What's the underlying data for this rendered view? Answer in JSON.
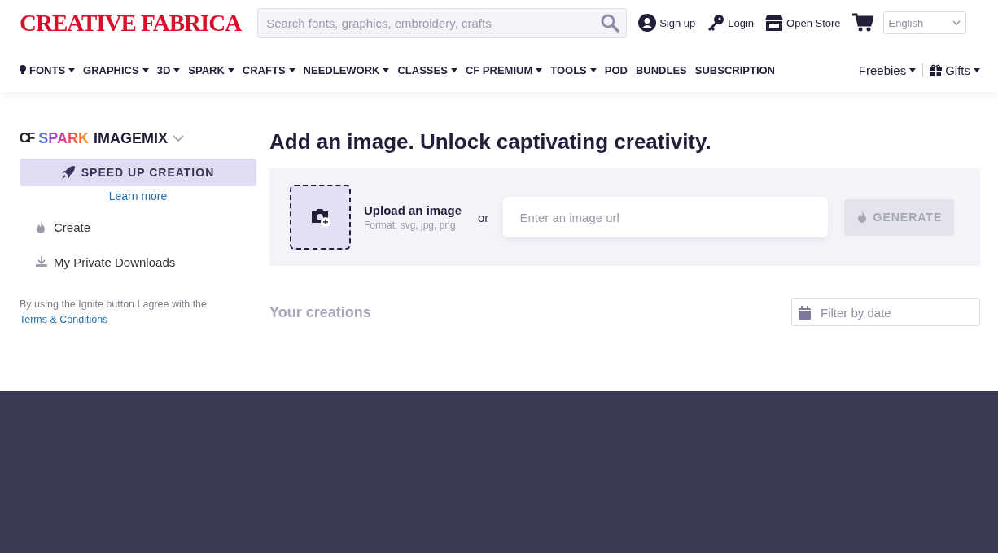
{
  "header": {
    "logo": "CREATIVE FABRICA",
    "search": {
      "placeholder": "Search fonts, graphics, embroidery, crafts"
    },
    "account_links": [
      {
        "kind": "user",
        "label": "Sign up"
      },
      {
        "kind": "key",
        "label": "Login"
      },
      {
        "kind": "store",
        "label": "Open Store"
      }
    ],
    "language": "English"
  },
  "nav": {
    "items": [
      {
        "label": "FONTS",
        "dropdown": true,
        "icon": true
      },
      {
        "label": "GRAPHICS",
        "dropdown": true,
        "icon": false
      },
      {
        "label": "3D",
        "dropdown": true,
        "icon": false
      },
      {
        "label": "SPARK",
        "dropdown": true,
        "icon": false
      },
      {
        "label": "CRAFTS",
        "dropdown": true,
        "icon": false
      },
      {
        "label": "NEEDLEWORK",
        "dropdown": true,
        "icon": false
      },
      {
        "label": "CLASSES",
        "dropdown": true,
        "icon": false
      },
      {
        "label": "CF PREMIUM",
        "dropdown": true,
        "icon": false
      },
      {
        "label": "TOOLS",
        "dropdown": true,
        "icon": false
      },
      {
        "label": "POD",
        "dropdown": false,
        "icon": false
      },
      {
        "label": "BUNDLES",
        "dropdown": false,
        "icon": false
      },
      {
        "label": "SUBSCRIPTION",
        "dropdown": false,
        "icon": false
      }
    ],
    "right_items": [
      {
        "label": "Freebies",
        "dropdown": true,
        "icon": false
      },
      {
        "label": "Gifts",
        "dropdown": true,
        "icon": true
      }
    ]
  },
  "sidebar": {
    "brand": {
      "prefix": "CF",
      "spark": "SPARK",
      "name": "IMAGEMIX"
    },
    "speed_button": "SPEED UP CREATION",
    "learn_more": "Learn more",
    "items": [
      {
        "kind": "flame",
        "label": "Create"
      },
      {
        "kind": "download",
        "label": "My Private Downloads"
      }
    ],
    "terms": {
      "text": "By using the Ignite button I agree with the",
      "link": "Terms & Conditions"
    }
  },
  "main": {
    "title": "Add an image. Unlock captivating creativity.",
    "upload": {
      "label": "Upload an image",
      "formats": "Format: svg, jpg, png"
    },
    "or": "or",
    "url_field": {
      "placeholder": "Enter an image url"
    },
    "generate": {
      "label": "GENERATE",
      "disabled": true
    },
    "creations_title": "Your creations",
    "filter": {
      "placeholder": "Filter by date"
    }
  }
}
